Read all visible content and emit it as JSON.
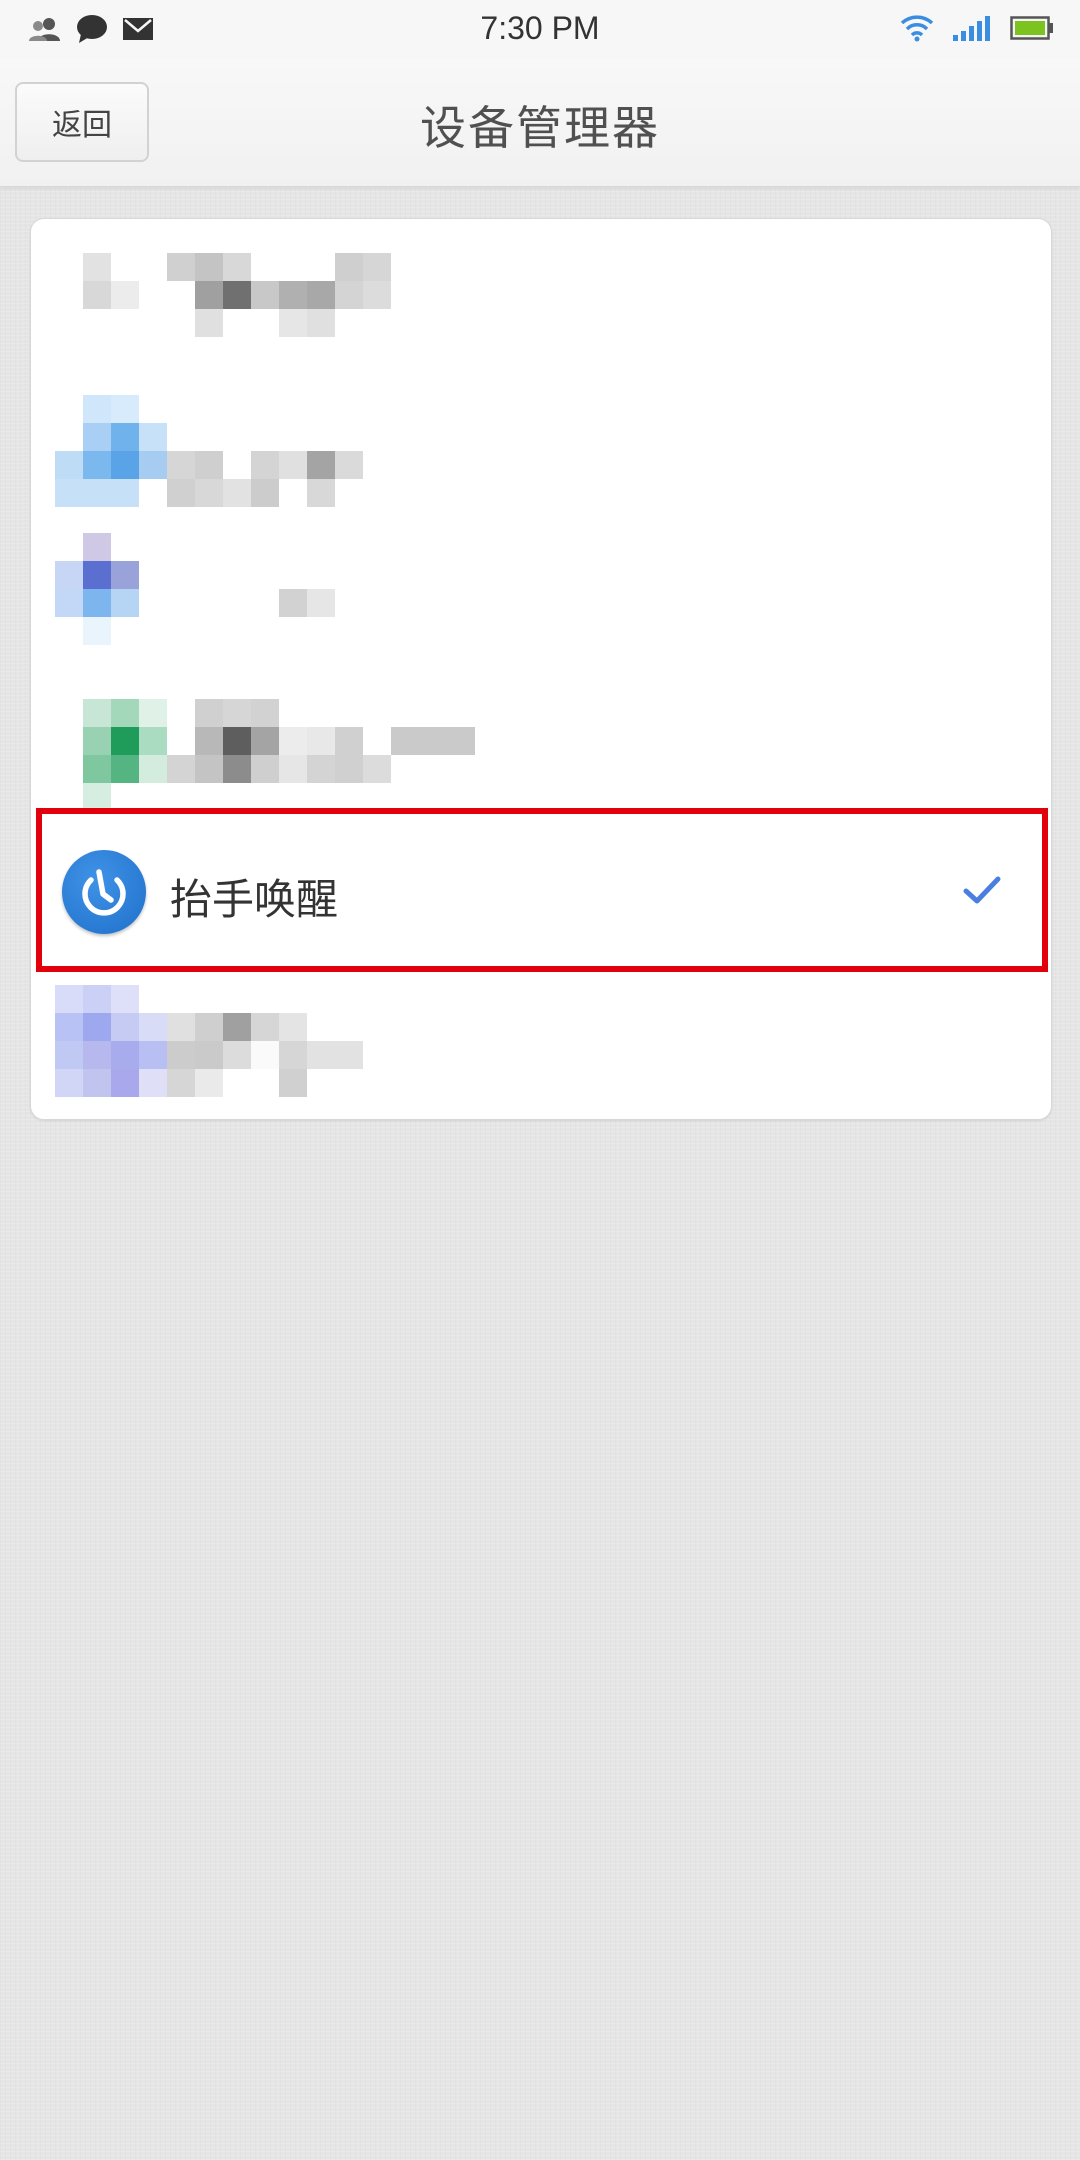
{
  "status_bar": {
    "time": "7:30 PM"
  },
  "header": {
    "back_label": "返回",
    "title": "设备管理器"
  },
  "device_list": {
    "selected_item": {
      "label": "抬手唤醒",
      "checked": true,
      "icon": "power-icon"
    }
  },
  "colors": {
    "highlight_border": "#e2000c",
    "check_color": "#4a7fe0",
    "icon_blue": "#1f6fcb"
  }
}
